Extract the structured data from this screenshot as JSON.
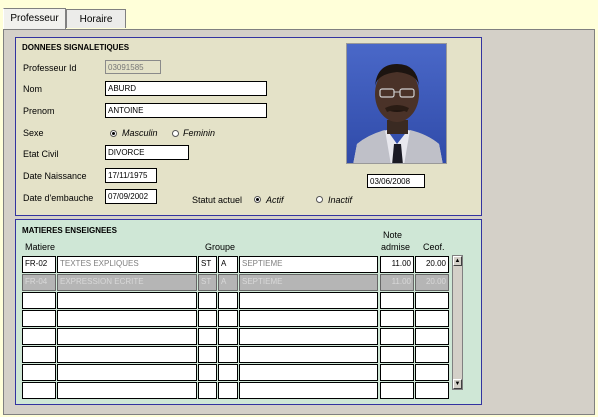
{
  "tabs": [
    {
      "label": "Professeur"
    },
    {
      "label": "Horaire"
    }
  ],
  "signaletique": {
    "title": "DONNEES SIGNALETIQUES",
    "professeur_id_label": "Professeur Id",
    "professeur_id": "03091585",
    "nom_label": "Nom",
    "nom": "ABURD",
    "prenom_label": "Prenom",
    "prenom": "ANTOINE",
    "sexe_label": "Sexe",
    "sexe_masculin": "Masculin",
    "sexe_feminin": "Feminin",
    "etat_civil_label": "Etat Civil",
    "etat_civil": "DIVORCE",
    "date_naissance_label": "Date Naissance",
    "date_naissance": "17/11/1975",
    "date_embauche_label": "Date d'embauche",
    "date_embauche": "07/09/2002",
    "statut_label": "Statut actuel",
    "statut_actif": "Actif",
    "statut_inactif": "Inactif",
    "photo_date": "03/06/2008"
  },
  "matieres": {
    "title": "MATIERES ENSEIGNEES",
    "headers": {
      "matiere": "Matiere",
      "groupe": "Groupe",
      "note_line1": "Note",
      "note_line2": "admise",
      "coef": "Ceof."
    },
    "rows": [
      {
        "code": "FR-02",
        "desc": "TEXTES EXPLIQUES",
        "g1": "ST",
        "g2": "A",
        "niveau": "SEPTIEME",
        "note": "11.00",
        "coef": "20.00"
      },
      {
        "code": "FR-04",
        "desc": "EXPRESSION ECRITE",
        "g1": "ST",
        "g2": "A",
        "niveau": "SEPTIEME",
        "note": "11.00",
        "coef": "20.00"
      }
    ]
  },
  "icons": {
    "photo": "person-photo-icon",
    "scroll_up": "arrow-up-icon",
    "scroll_down": "arrow-down-icon"
  }
}
